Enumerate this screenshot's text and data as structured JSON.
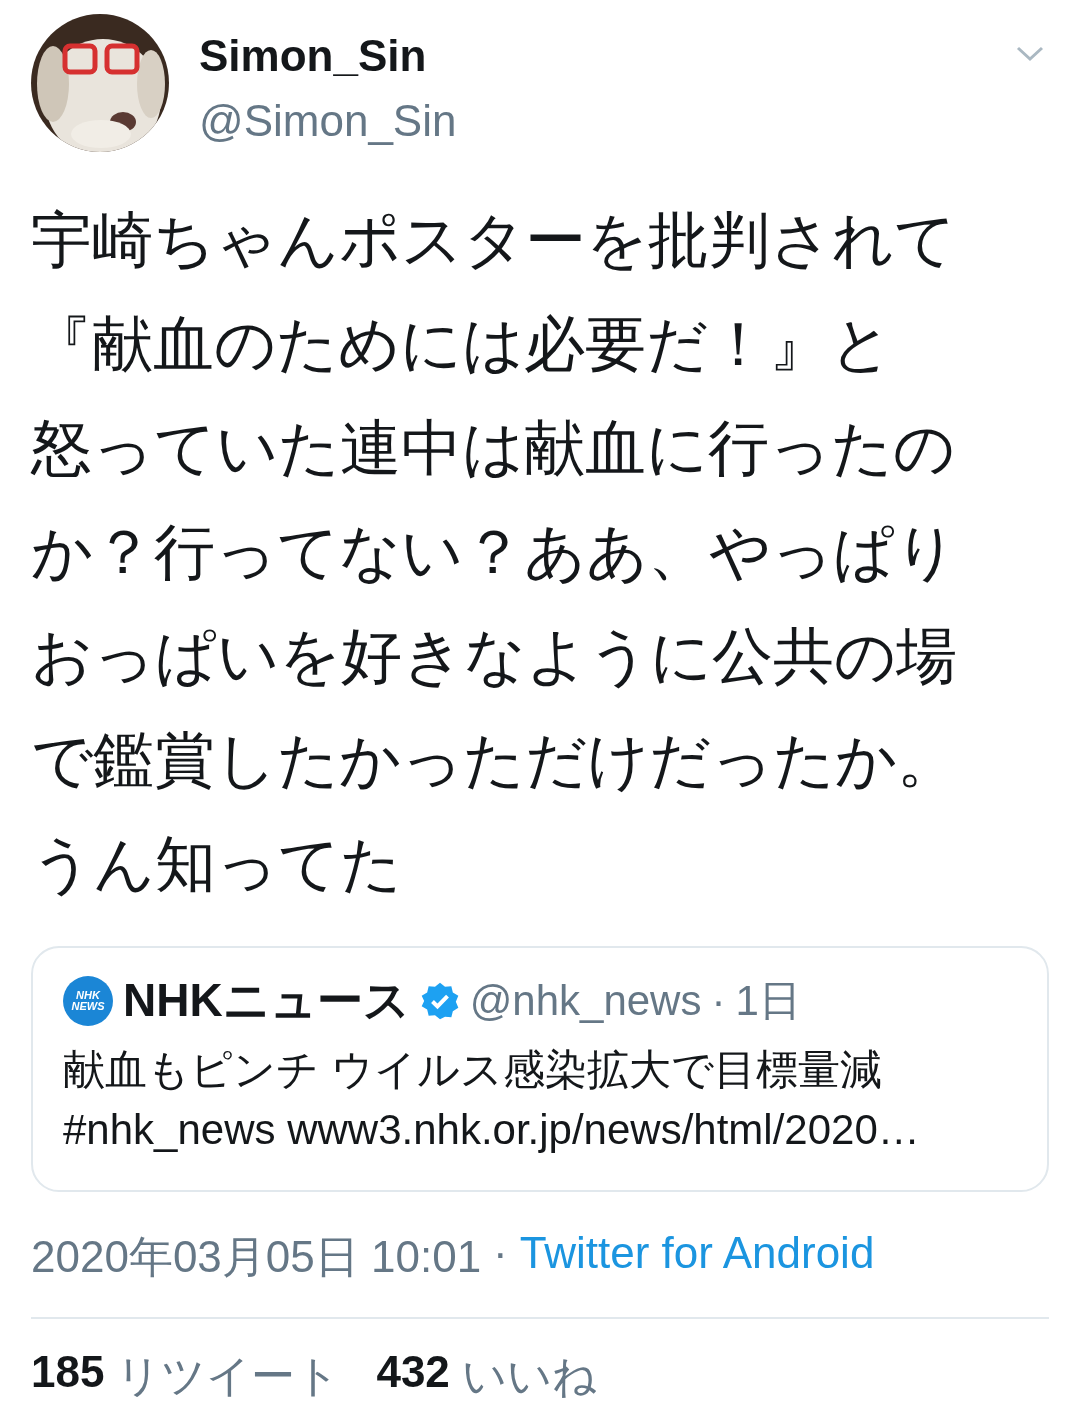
{
  "author": {
    "name": "Simon_Sin",
    "handle": "@Simon_Sin"
  },
  "tweet": {
    "lines": [
      "宇崎ちゃんポスターを批判されて",
      "『献血のためには必要だ！』と",
      "怒っていた連中は献血に行ったの",
      "か？行ってない？ああ、やっぱり",
      "おっぱいを好きなように公共の場",
      "で鑑賞したかっただけだったか。",
      "うん知ってた"
    ]
  },
  "quote": {
    "logo_lines": [
      "NHK",
      "NEWS"
    ],
    "name": "NHKニュース",
    "verified": true,
    "handle": "@nhk_news",
    "separator": "·",
    "age": "1日",
    "lines": [
      "献血もピンチ ウイルス感染拡大で目標量減",
      "#nhk_news www3.nhk.or.jp/news/html/2020…"
    ]
  },
  "meta": {
    "timestamp": "2020年03月05日 10:01",
    "separator": "·",
    "source": "Twitter for Android"
  },
  "stats": [
    {
      "count": "185",
      "label": "リツイート"
    },
    {
      "count": "432",
      "label": "いいね"
    }
  ]
}
